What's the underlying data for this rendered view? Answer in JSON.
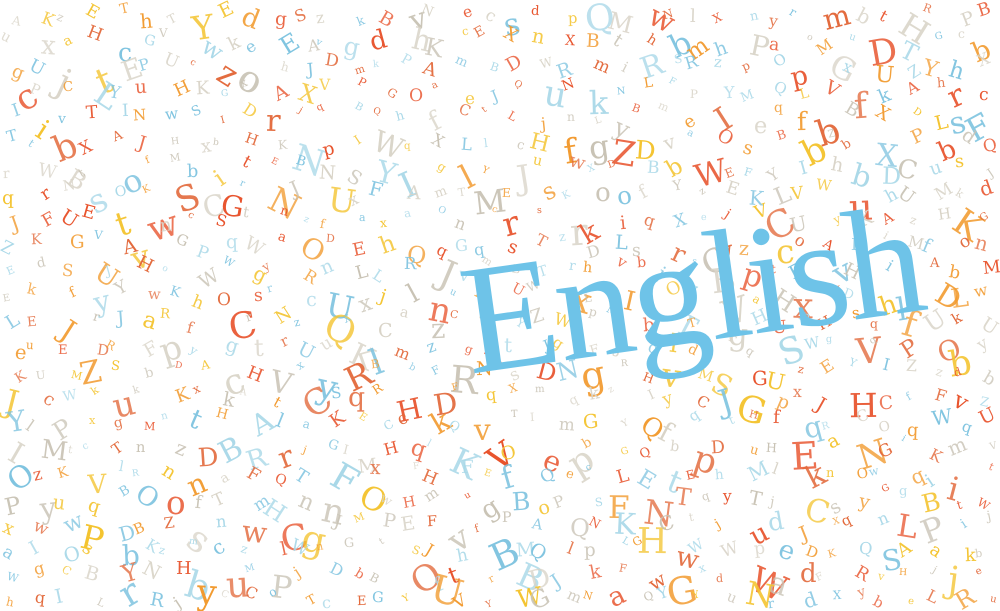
{
  "main_word": "English",
  "colors": {
    "main_word": "#6ec3e8",
    "palette": [
      "#e8522b",
      "#f29a2e",
      "#f4c430",
      "#7fc4e0",
      "#a8d8e8",
      "#d9d4c8",
      "#c9c3b5",
      "#e36a3c"
    ],
    "background": "#ffffff"
  },
  "letters": "AKzEThTYEdgSzkBvNecsdpQMwNlXnyrmbtHRPBuxaHcGVwkeEAvgdhKcEXnXBthbmhPaoMuDTGcbgUjtEPUczohJDmkPAmBDWRmiRSRzpOpGxUZYhXcPCLYuHKGxAXVPGOaeJQuNkNLFPYMQLVfkAhrcIivTINwSIDrjqBQhfCtLjnLyBmeIeqfbBXDLsFTtbXAJHxbHKNpIWqXLlcHfgZDvaOsBbZbXPbdQrWBtofMbitEBNSYIglYJuwXDBbWEFYIhbDCusJqrNsOKSCGrNJUxFAmTMEsKoofYzEKLVWuhUMkdJFUEtwncStnzfaxaOncrsrkiqXejVCUyKAzHKGZKGVAvGPqWaODEhQqGqsTzDLsrOvzcoALiMfonEdSUJHoWWgyRnLLRJvmBTrhvbjsBptEvHiBAbMEkfyYwKhOsrcUxjlnuRUWxLIoOZVaHxVDhlDLwLEJrJaRfCrNzQxCazCtYZWpMbTTgHUnHsqfUkUeuEDRFpygtrUuKlmzgxtJgFjqldrqSWgVqPObyKUMZSbDAcHVxyRBbFRNsDNgRHvMSGUzEYIZzdbJcWkukKxkAtCSqRHDFqXmqkzIyCJGpxJHCfFvZYlPxgMntHAlaKECckQvTImGYQfqtHfqRCOqWqUIMtcTnzDBRrjGIHqlKVOepbGQbpDuHEaNGiKmVOzKVlRnnaFQTFMxFHFEfQecLEtEhMlknOwqiitPyuqBOofTmHnnOwHmugBoPSFNTqyTjCsyGgBtWxwwPDBZsnwCgJMPEFvfPAQNKHCtjudJXqnLPijaIOsbKzmczlWnGtSJhBMQlpLGwWWpeDKQSAakbWgCBYNHbuMPjDbBOftrBDJkFwGxdWadFRvHjjehqILrRjyCCoTcEGYUVYWGmNaQYYuNrdXybeLRuTacQhVsEQnoaDWhXWWkrjhAgxApwXHKnAGXnqDMHTfZnRXxKbmZIVQkzBjwWRzajqVgnlCsWcEdJmncjMFjpkMZPDQuHnXQhUAptLTSXqNdbIjgnZRWEqvufasrupuNNumuzRLKiiBIXxYTGWRiEMgMuyiNQmdPDtVMJUEqjaKfGVrhlFMJSjZCBJlzDhiQFPZwmUhwzPexJlvuUVPzKJFBjmzjbPhUqInTWIRxIAAwJVWMgVPldgPiYpGsvQWhcgcQlOdKmpOAjYTcYYMhIqLzPbTfOlXixaVLjBZIWDkGrUEDmoKhVmnaltLaEhmWhgOHHTVMxJIikbAPsmBxDkkuCcdqtzFPsCclvUmjGSzvMwcNVuLTNtkqyRTpiLlbyBqCDKQwMtenrUKvGOvOTKlucnRPdPrMlqZmTxZCuzESiPsQpfAyvvoRSpoikkLHBqBfunaOSrAzKWcSQzHgehnyBkopwpTdtBFdkBnOnbYsekgaJXECZFCMkGArZuadmTwkJVcRgJaFOkxnjagSvTJ"
}
